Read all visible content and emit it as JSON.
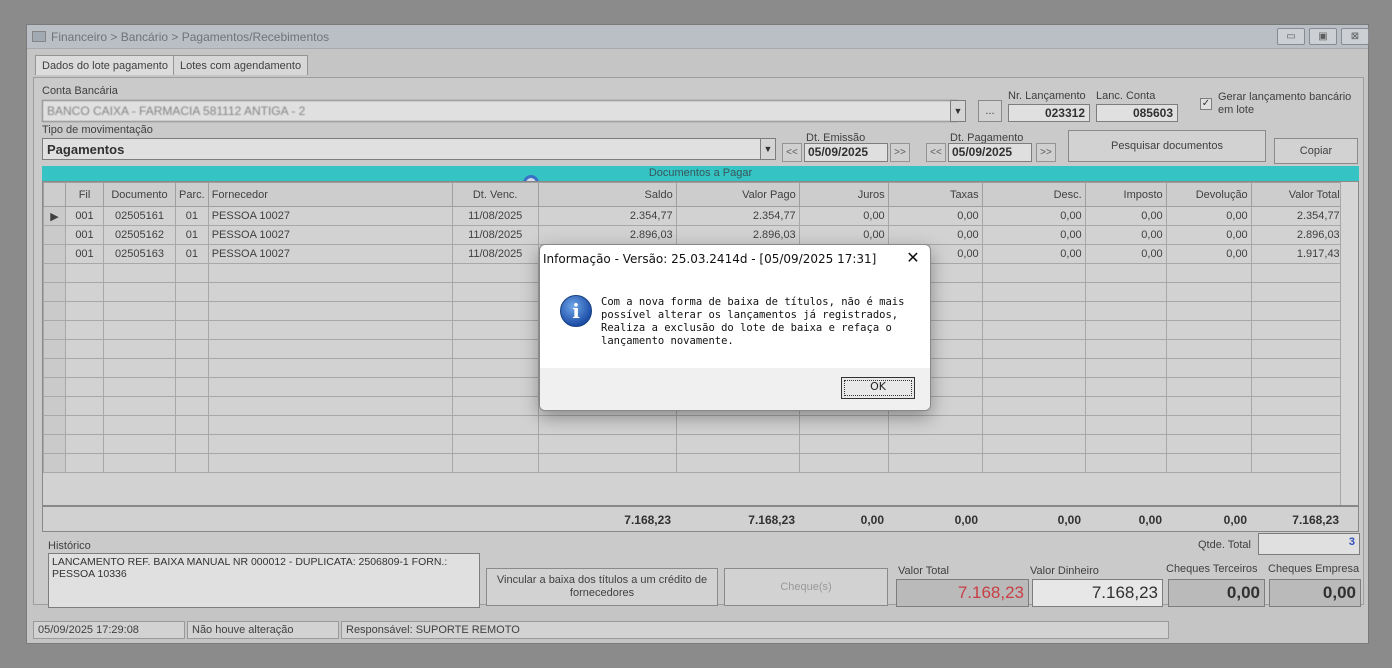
{
  "window": {
    "title": "Financeiro > Bancário > Pagamentos/Recebimentos",
    "controls": [
      "▭",
      "▣",
      "⊠"
    ]
  },
  "tabs": [
    "Dados do lote pagamento",
    "Lotes com agendamento"
  ],
  "form": {
    "conta_label": "Conta Bancária",
    "conta_value": "BANCO CAIXA - FARMACIA 581112 ANTIGA - 2",
    "conta_button": "...",
    "nr_lancamento_label": "Nr. Lançamento",
    "nr_lancamento_value": "023312",
    "lanc_conta_label": "Lanc. Conta",
    "lanc_conta_value": "085603",
    "gerar_label": "Gerar lançamento bancário em lote",
    "tipo_label": "Tipo de movimentação",
    "tipo_value": "Pagamentos",
    "dt_emissao_label": "Dt. Emissão",
    "dt_emissao_value": "05/09/2025",
    "dt_pagamento_label": "Dt. Pagamento",
    "dt_pagamento_value": "05/09/2025",
    "nav_prev": "<<",
    "nav_next": ">>",
    "pesquisar": "Pesquisar documentos",
    "copiar": "Copiar"
  },
  "grid": {
    "banner": "Documentos a Pagar",
    "columns": [
      "",
      "Fil",
      "Documento",
      "Parc.",
      "Fornecedor",
      "Dt. Venc.",
      "Saldo",
      "Valor Pago",
      "Juros",
      "Taxas",
      "Desc.",
      "Imposto",
      "Devolução",
      "Valor Total"
    ],
    "rows": [
      [
        "▶",
        "001",
        "02505161",
        "01",
        "PESSOA 10027",
        "11/08/2025",
        "2.354,77",
        "2.354,77",
        "0,00",
        "0,00",
        "0,00",
        "0,00",
        "0,00",
        "2.354,77"
      ],
      [
        "",
        "001",
        "02505162",
        "01",
        "PESSOA 10027",
        "11/08/2025",
        "2.896,03",
        "2.896,03",
        "0,00",
        "0,00",
        "0,00",
        "0,00",
        "0,00",
        "2.896,03"
      ],
      [
        "",
        "001",
        "02505163",
        "01",
        "PESSOA 10027",
        "11/08/2025",
        "",
        "",
        "",
        "0,00",
        "0,00",
        "0,00",
        "0,00",
        "1.917,43"
      ]
    ],
    "totals": [
      "7.168,23",
      "7.168,23",
      "0,00",
      "0,00",
      "0,00",
      "0,00",
      "0,00",
      "7.168,23"
    ]
  },
  "historico": {
    "label": "Histórico",
    "text": "LANCAMENTO REF. BAIXA MANUAL NR 000012 - DUPLICATA: 2506809-1 FORN.: PESSOA 10336"
  },
  "bottom": {
    "vincular": "Vincular a baixa dos títulos a um crédito de fornecedores",
    "cheques_btn": "Cheque(s)",
    "qtde_label": "Qtde. Total",
    "qtde_value": "3",
    "valor_total_label": "Valor Total",
    "valor_total_value": "7.168,23",
    "valor_dinheiro_label": "Valor Dinheiro",
    "valor_dinheiro_value": "7.168,23",
    "cheques_terceiros_label": "Cheques Terceiros",
    "cheques_terceiros_value": "0,00",
    "cheques_empresa_label": "Cheques Empresa",
    "cheques_empresa_value": "0,00"
  },
  "status": {
    "datetime": "05/09/2025 17:29:08",
    "change": "Não houve alteração",
    "user": "Responsável: SUPORTE REMOTO"
  },
  "dialog": {
    "title": "Informação - Versão: 25.03.2414d - [05/09/2025 17:31]",
    "close": "✕",
    "icon": "i",
    "message": "Com a nova forma de baixa de títulos, não é mais possível alterar os lançamentos já registrados,\nRealiza a exclusão do lote de baixa e refaça o lançamento novamente.",
    "ok": "OK"
  },
  "colors": {
    "banner": "#27d4d3",
    "total_red": "#d9333a",
    "info_blue": "#1d4fa9"
  }
}
